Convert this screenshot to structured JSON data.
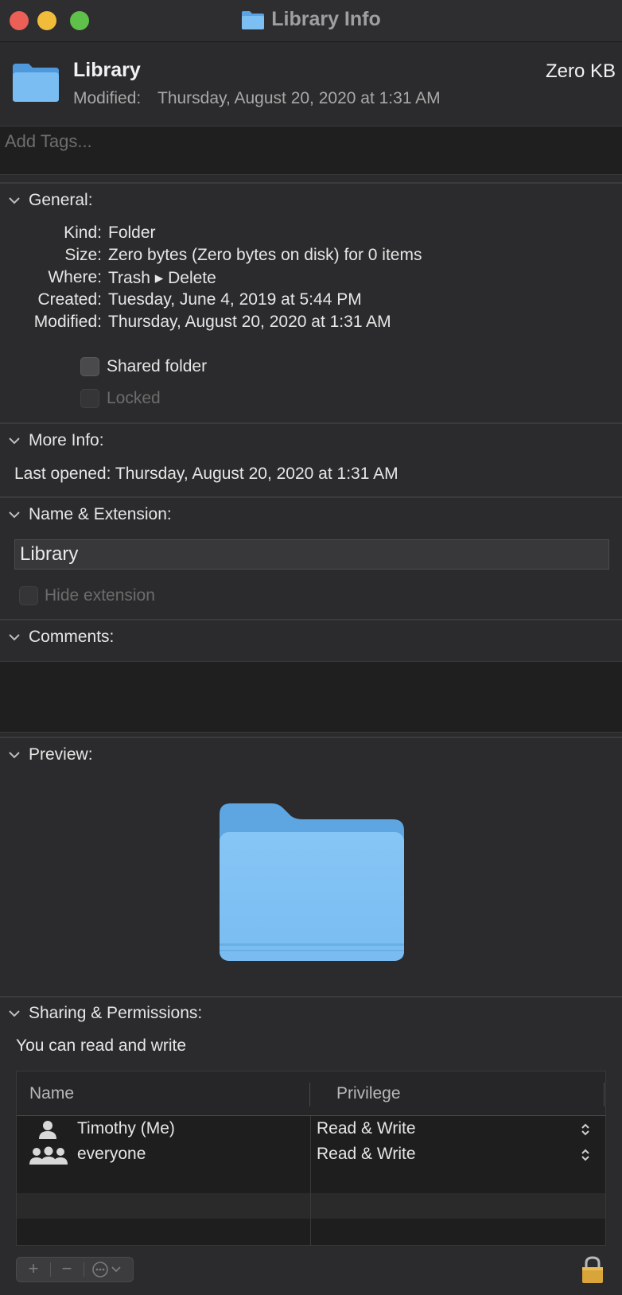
{
  "window": {
    "title": "Library Info"
  },
  "header": {
    "name": "Library",
    "size": "Zero KB",
    "modified_label": "Modified:",
    "modified_value": "Thursday, August 20, 2020 at 1:31 AM"
  },
  "tags": {
    "placeholder": "Add Tags..."
  },
  "general": {
    "heading": "General:",
    "rows": [
      {
        "label": "Kind:",
        "value": "Folder"
      },
      {
        "label": "Size:",
        "value": "Zero bytes (Zero bytes on disk) for 0 items"
      },
      {
        "label": "Where:",
        "value": "Trash ▸ Delete"
      },
      {
        "label": "Created:",
        "value": "Tuesday, June 4, 2019 at 5:44 PM"
      },
      {
        "label": "Modified:",
        "value": "Thursday, August 20, 2020 at 1:31 AM"
      }
    ],
    "shared_folder": {
      "label": "Shared folder",
      "checked": false
    },
    "locked": {
      "label": "Locked",
      "checked": false,
      "disabled": true
    }
  },
  "more_info": {
    "heading": "More Info:",
    "last_opened": "Last opened: Thursday, August 20, 2020 at 1:31 AM"
  },
  "name_extension": {
    "heading": "Name & Extension:",
    "value": "Library",
    "hide_extension": {
      "label": "Hide extension",
      "checked": false,
      "disabled": true
    }
  },
  "comments": {
    "heading": "Comments:",
    "value": ""
  },
  "preview": {
    "heading": "Preview:"
  },
  "sharing": {
    "heading": "Sharing & Permissions:",
    "note": "You can read and write",
    "columns": [
      "Name",
      "Privilege"
    ],
    "rows": [
      {
        "name": "Timothy (Me)",
        "privilege": "Read & Write",
        "icon": "person-icon"
      },
      {
        "name": "everyone",
        "privilege": "Read & Write",
        "icon": "group-icon"
      }
    ]
  },
  "toolbar": {
    "add": "+",
    "remove": "−",
    "action": "⋯"
  },
  "colors": {
    "background": "#2b2b2d",
    "folder_blue": "#6fb4ec",
    "close": "#ec5f57",
    "minimize": "#f2bc3b",
    "zoom": "#5fc14a"
  }
}
